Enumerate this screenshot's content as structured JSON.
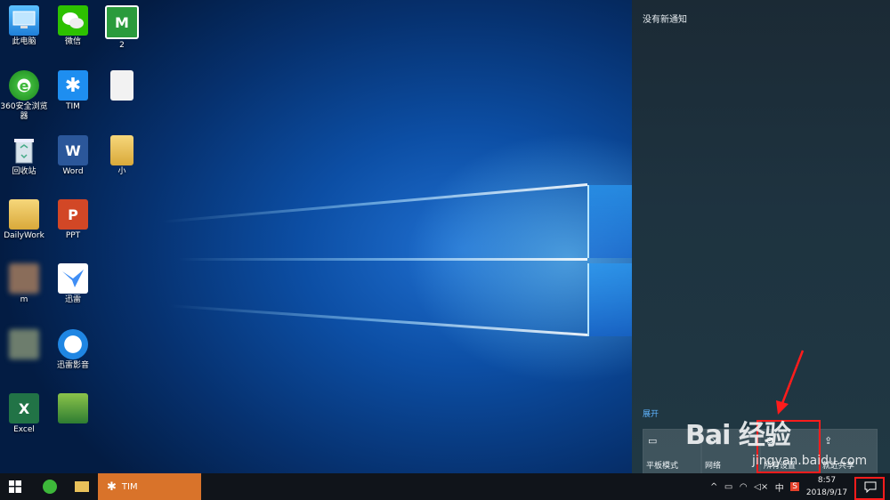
{
  "desktop": {
    "icons": [
      {
        "label": "此电脑",
        "icon": "computer-icon",
        "color": "#3aa0f0"
      },
      {
        "label": "微信",
        "icon": "wechat-icon",
        "color": "#2dc100"
      },
      {
        "label": "2",
        "icon": "app-icon",
        "color": "#2a9b3c"
      },
      {
        "label": "360安全浏览器",
        "icon": "browser-360-icon",
        "color": "#3db83a"
      },
      {
        "label": "TIM",
        "icon": "tim-icon",
        "color": "#1e8ef0"
      },
      {
        "label": "",
        "icon": "document-icon",
        "color": "#f2f2f2"
      },
      {
        "label": "回收站",
        "icon": "recycle-bin-icon",
        "color": "#9ab5c8"
      },
      {
        "label": "Word",
        "icon": "word-icon",
        "color": "#2b579a"
      },
      {
        "label": "小",
        "icon": "folder-icon",
        "color": "#e8c15a"
      },
      {
        "label": "DailyWork",
        "icon": "folder-icon",
        "color": "#e8c15a"
      },
      {
        "label": "PPT",
        "icon": "powerpoint-icon",
        "color": "#d24726"
      },
      {
        "label": "m",
        "icon": "app-icon",
        "color": "#8a6d5a"
      },
      {
        "label": "迅雷",
        "icon": "xunlei-icon",
        "color": "#3f8ef5"
      },
      {
        "label": "",
        "icon": "app-icon",
        "color": "#6d7d6d"
      },
      {
        "label": "迅雷影音",
        "icon": "xunlei-player-icon",
        "color": "#1f86e3"
      },
      {
        "label": "Excel",
        "icon": "excel-icon",
        "color": "#217346"
      },
      {
        "label": "",
        "icon": "app-icon",
        "color": "#4d8f2d"
      }
    ]
  },
  "action_center": {
    "no_notifications": "没有新通知",
    "expand_label": "展开",
    "tiles": [
      {
        "label": "平板模式",
        "icon": "tablet-mode-icon"
      },
      {
        "label": "网络",
        "icon": "network-icon"
      },
      {
        "label": "所有设置",
        "icon": "settings-icon"
      },
      {
        "label": "就近共享",
        "icon": "nearby-share-icon"
      }
    ]
  },
  "taskbar": {
    "task_label": "TIM",
    "tray": {
      "ime": "中",
      "chevron": "^"
    },
    "clock_time": "8:57",
    "clock_date": "2018/9/17"
  },
  "watermark": {
    "text": "Bai 经验",
    "url": "jingyan.baidu.com"
  },
  "colors": {
    "highlight": "#ff1c1c",
    "accent": "#5fb4ff",
    "task_active": "#d9732a"
  }
}
